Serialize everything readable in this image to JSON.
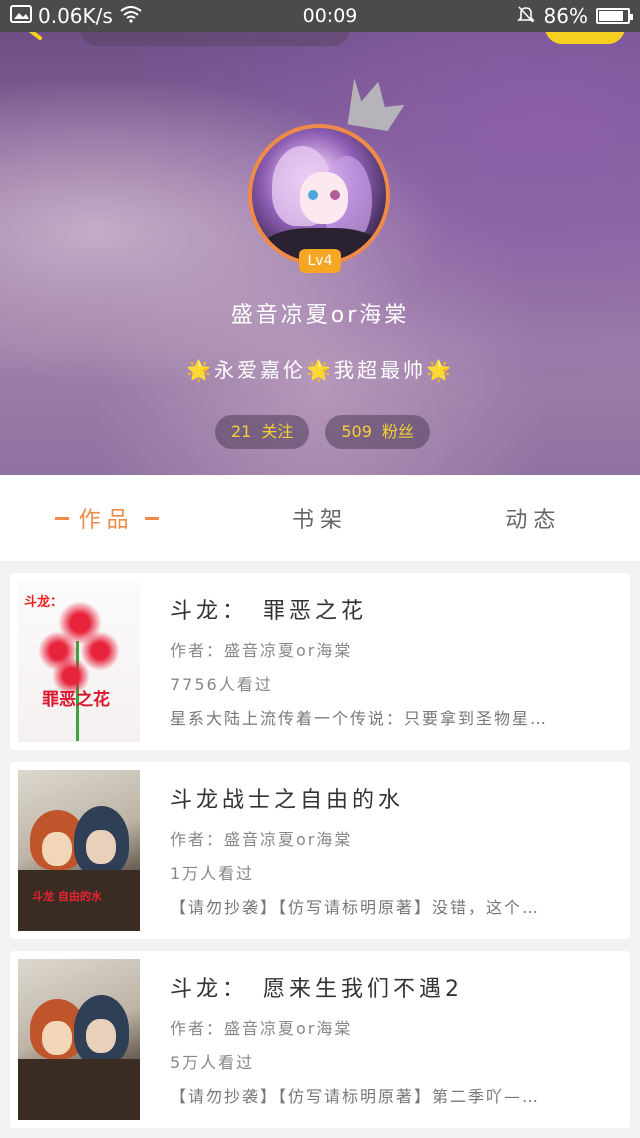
{
  "status_bar": {
    "speed": "0.06K/s",
    "time": "00:09",
    "battery": "86%",
    "battery_level": 0.86
  },
  "profile": {
    "level": "Lv4",
    "username": "盛音凉夏or海棠",
    "signature": "🌟永爱嘉伦🌟我超最帅🌟",
    "following_count": "21",
    "following_label": "关注",
    "followers_count": "509",
    "followers_label": "粉丝"
  },
  "tabs": [
    {
      "label": "作品",
      "active": true
    },
    {
      "label": "书架",
      "active": false
    },
    {
      "label": "动态",
      "active": false
    }
  ],
  "books": [
    {
      "title": "斗龙：　罪恶之花",
      "author": "作者：盛音凉夏or海棠",
      "views": "7756人看过",
      "desc": "星系大陆上流传着一个传说：只要拿到圣物星…",
      "cover_top": "斗龙：",
      "cover_title": "罪恶之花"
    },
    {
      "title": "斗龙战士之自由的水",
      "author": "作者：盛音凉夏or海棠",
      "views": "1万人看过",
      "desc": "【请勿抄袭】【仿写请标明原著】没错，这个…",
      "cover_title": "斗龙 自由的水"
    },
    {
      "title": "斗龙：　愿来生我们不遇2",
      "author": "作者：盛音凉夏or海棠",
      "views": "5万人看过",
      "desc": "【请勿抄袭】【仿写请标明原著】第二季吖—…"
    }
  ]
}
